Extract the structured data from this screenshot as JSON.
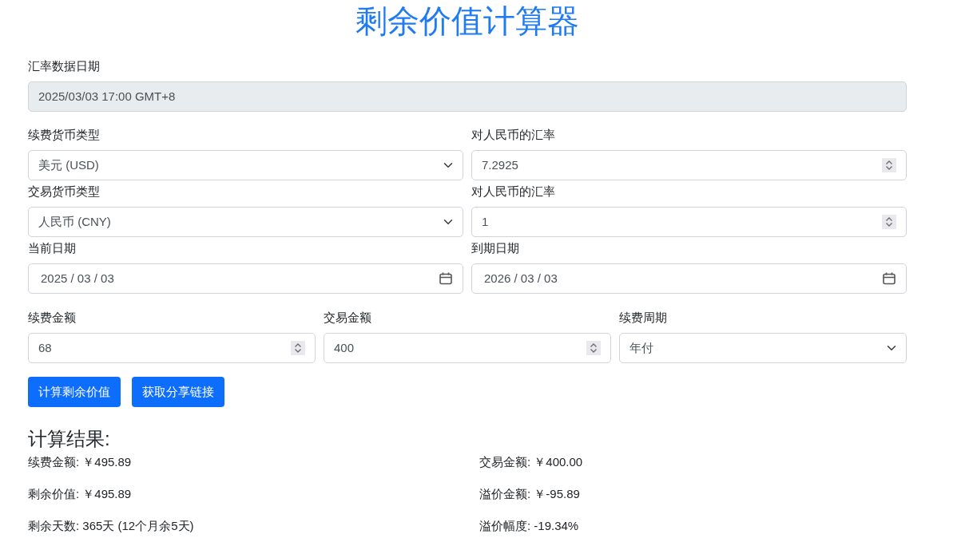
{
  "title": "剩余价值计算器",
  "rate_date": {
    "label": "汇率数据日期",
    "kind": "readonly",
    "value": "2025/03/03 17:00 GMT+8"
  },
  "rows": [
    [
      {
        "label": "续费货币类型",
        "kind": "select",
        "value": "美元 (USD)"
      },
      {
        "label": "对人民币的汇率",
        "kind": "number",
        "value": "7.2925"
      }
    ],
    [
      {
        "label": "交易货币类型",
        "kind": "select",
        "value": "人民币 (CNY)"
      },
      {
        "label": "对人民币的汇率",
        "kind": "number",
        "value": "1"
      }
    ],
    [
      {
        "label": "当前日期",
        "kind": "date",
        "value": "2025 / 03 / 03"
      },
      {
        "label": "到期日期",
        "kind": "date",
        "value": "2026 / 03 / 03"
      }
    ],
    [
      {
        "label": "续费金额",
        "kind": "number",
        "value": "68"
      },
      {
        "label": "交易金额",
        "kind": "number",
        "value": "400"
      },
      {
        "label": "续费周期",
        "kind": "select",
        "value": "年付"
      }
    ]
  ],
  "buttons": [
    "计算剩余价值",
    "获取分享链接"
  ],
  "results": {
    "heading": "计算结果:",
    "items": [
      "续费金额: ￥495.89",
      "交易金额: ￥400.00",
      "剩余价值: ￥495.89",
      "溢价金额: ￥-95.89",
      "剩余天数: 365天 (12个月余5天)",
      "溢价幅度: -19.34%"
    ]
  }
}
